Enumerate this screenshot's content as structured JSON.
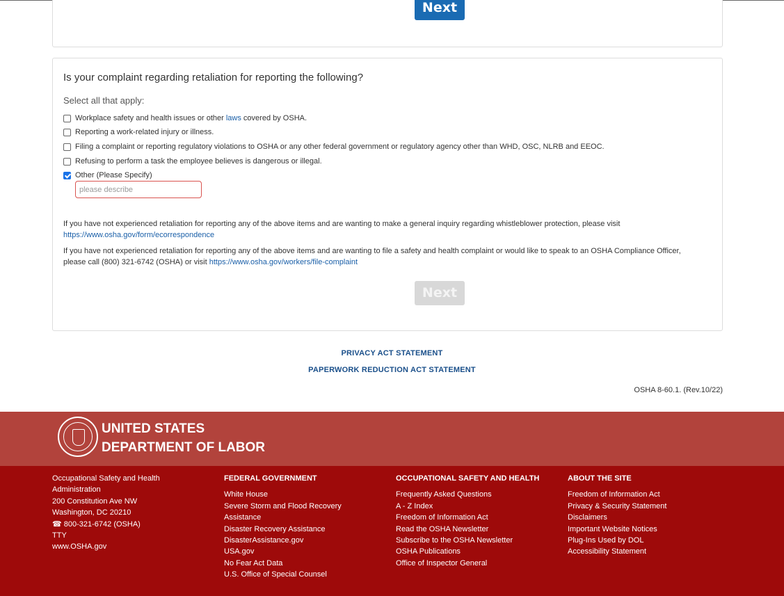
{
  "buttons": {
    "next_top": "Next",
    "next_bottom": "Next"
  },
  "question": {
    "title": "Is your complaint regarding retaliation for reporting the following?",
    "hint": "Select all that apply:",
    "options": [
      {
        "pre": "Workplace safety and health issues or other ",
        "link": "laws",
        "post": " covered by OSHA.",
        "checked": false
      },
      {
        "pre": "Reporting a work-related injury or illness.",
        "link": "",
        "post": "",
        "checked": false
      },
      {
        "pre": "Filing a complaint or reporting regulatory violations to OSHA or any other federal government or regulatory agency other than WHD, OSC, NLRB and EEOC.",
        "link": "",
        "post": "",
        "checked": false
      },
      {
        "pre": "Refusing to perform a task the employee believes is dangerous or illegal.",
        "link": "",
        "post": "",
        "checked": false
      },
      {
        "pre": "Other (Please Specify)",
        "link": "",
        "post": "",
        "checked": true
      }
    ],
    "describe_placeholder": "please describe"
  },
  "info": {
    "p1_text": "If you have not experienced retaliation for reporting any of the above items and are wanting to make a general inquiry regarding whistleblower protection, please visit",
    "p1_link": "https://www.osha.gov/form/ecorrespondence",
    "p2_text_a": "If you have not experienced retaliation for reporting any of the above items and are wanting to file a safety and health complaint or would like to speak to an OSHA Compliance Officer,",
    "p2_text_b": "please call (800) 321-6742 (OSHA) or visit",
    "p2_link": "https://www.osha.gov/workers/file-complaint"
  },
  "statements": {
    "privacy": "PRIVACY ACT STATEMENT",
    "paperwork": "PAPERWORK REDUCTION ACT STATEMENT"
  },
  "form_number": "OSHA 8-60.1. (Rev.10/22)",
  "footer": {
    "dept_line1": "UNITED STATES",
    "dept_line2": "DEPARTMENT OF LABOR",
    "address": [
      "Occupational Safety and Health",
      "Administration",
      "200 Constitution Ave NW",
      "Washington, DC 20210",
      "☎ 800-321-6742 (OSHA)",
      "TTY",
      "www.OSHA.gov"
    ],
    "fed_head": "FEDERAL GOVERNMENT",
    "fed_links": [
      "White House",
      "Severe Storm and Flood Recovery",
      "Assistance",
      "Disaster Recovery Assistance",
      "DisasterAssistance.gov",
      "USA.gov",
      "No Fear Act Data",
      "U.S. Office of Special Counsel"
    ],
    "osh_head": "OCCUPATIONAL SAFETY AND HEALTH",
    "osh_links": [
      "Frequently Asked Questions",
      "A - Z Index",
      "Freedom of Information Act",
      "Read the OSHA Newsletter",
      "Subscribe to the OSHA Newsletter",
      "OSHA Publications",
      "Office of Inspector General"
    ],
    "about_head": "ABOUT THE SITE",
    "about_links": [
      "Freedom of Information Act",
      "Privacy & Security Statement",
      "Disclaimers",
      "Important Website Notices",
      "Plug-Ins Used by DOL",
      "Accessibility Statement"
    ]
  },
  "colors": {
    "primary_button": "#1a6bb3",
    "footer_top": "#b2433c",
    "footer_main": "#9e0a0a",
    "error_border": "#d9534f"
  }
}
